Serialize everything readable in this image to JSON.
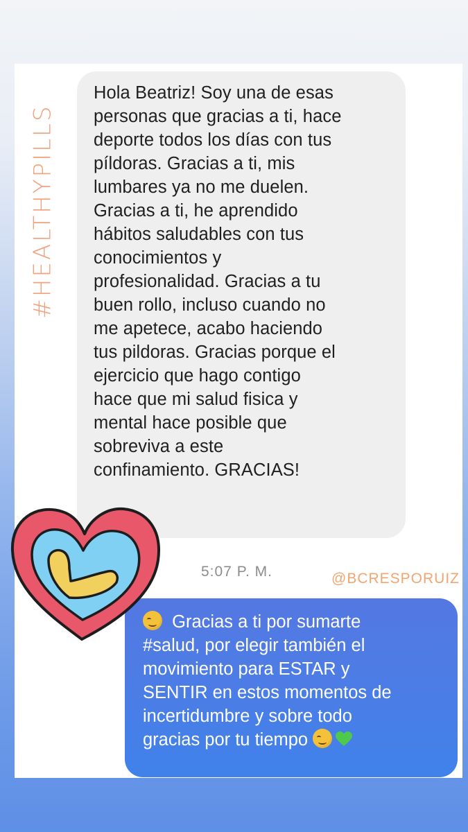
{
  "story": {
    "hashtag_overlay": "#HEALTHYPILLS",
    "handle_overlay": "@BCRESPORUIZ"
  },
  "incoming_message": {
    "text": "Hola Beatriz! Soy una de esas personas que gracias a ti, hace deporte todos los días con tus píldoras. Gracias a ti, mis lumbares ya no me duelen. Gracias a ti, he aprendido hábitos saludables con tus conocimientos y profesionalidad. Gracias a tu buen rollo, incluso cuando no me apetece, acabo haciendo tus pildoras. Gracias porque el ejercicio que hago contigo hace que mi salud fisica y mental hace posible que sobreviva a este confinamiento. GRACIAS!",
    "lines": [
      "Hola Beatriz! Soy una de esas",
      "personas que gracias a ti, hace",
      "deporte todos los días con tus",
      "píldoras. Gracias a ti, mis",
      "lumbares ya no me duelen.",
      "Gracias a ti, he aprendido",
      "hábitos saludables con tus",
      "conocimientos y",
      "profesionalidad. Gracias a tu",
      "buen rollo, incluso cuando no",
      "me apetece, acabo haciendo",
      "tus pildoras. Gracias porque el",
      "ejercicio que hago contigo",
      "hace que mi salud fisica y",
      "mental hace posible que",
      "sobreviva a este",
      "confinamiento. GRACIAS!"
    ]
  },
  "timestamp": "5:07 P. M.",
  "outgoing_message": {
    "line1_text": "Gracias a ti por sumarte",
    "line2": "#salud, por elegir también el",
    "line3": "movimiento para ESTAR y",
    "line4": "SENTIR en estos momentos de",
    "line5": "incertidumbre y sobre todo",
    "line6_text": "gracias por tu tiempo",
    "leading_emoji": "smiling-face-icon",
    "trailing_emojis": [
      "smiling-face-icon",
      "green-heart-icon"
    ]
  },
  "colors": {
    "incoming_bubble": "#efefef",
    "outgoing_bubble": "#4b7de6",
    "hashtag_overlay": "#f3a07c",
    "handle_overlay": "#f1a56f",
    "sticker_red": "#e8576a",
    "sticker_blue": "#7fd0f2",
    "sticker_yellow": "#f2d05e",
    "green_heart": "#4fc94a"
  }
}
